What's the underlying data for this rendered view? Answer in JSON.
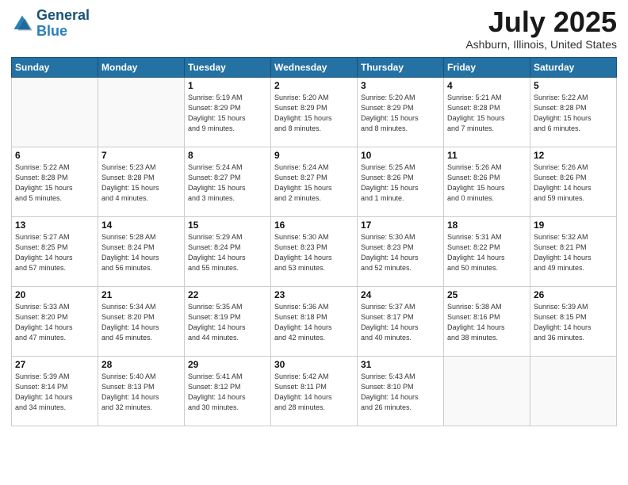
{
  "header": {
    "logo_line1": "General",
    "logo_line2": "Blue",
    "month": "July 2025",
    "location": "Ashburn, Illinois, United States"
  },
  "weekdays": [
    "Sunday",
    "Monday",
    "Tuesday",
    "Wednesday",
    "Thursday",
    "Friday",
    "Saturday"
  ],
  "weeks": [
    [
      {
        "day": "",
        "info": ""
      },
      {
        "day": "",
        "info": ""
      },
      {
        "day": "1",
        "info": "Sunrise: 5:19 AM\nSunset: 8:29 PM\nDaylight: 15 hours\nand 9 minutes."
      },
      {
        "day": "2",
        "info": "Sunrise: 5:20 AM\nSunset: 8:29 PM\nDaylight: 15 hours\nand 8 minutes."
      },
      {
        "day": "3",
        "info": "Sunrise: 5:20 AM\nSunset: 8:29 PM\nDaylight: 15 hours\nand 8 minutes."
      },
      {
        "day": "4",
        "info": "Sunrise: 5:21 AM\nSunset: 8:28 PM\nDaylight: 15 hours\nand 7 minutes."
      },
      {
        "day": "5",
        "info": "Sunrise: 5:22 AM\nSunset: 8:28 PM\nDaylight: 15 hours\nand 6 minutes."
      }
    ],
    [
      {
        "day": "6",
        "info": "Sunrise: 5:22 AM\nSunset: 8:28 PM\nDaylight: 15 hours\nand 5 minutes."
      },
      {
        "day": "7",
        "info": "Sunrise: 5:23 AM\nSunset: 8:28 PM\nDaylight: 15 hours\nand 4 minutes."
      },
      {
        "day": "8",
        "info": "Sunrise: 5:24 AM\nSunset: 8:27 PM\nDaylight: 15 hours\nand 3 minutes."
      },
      {
        "day": "9",
        "info": "Sunrise: 5:24 AM\nSunset: 8:27 PM\nDaylight: 15 hours\nand 2 minutes."
      },
      {
        "day": "10",
        "info": "Sunrise: 5:25 AM\nSunset: 8:26 PM\nDaylight: 15 hours\nand 1 minute."
      },
      {
        "day": "11",
        "info": "Sunrise: 5:26 AM\nSunset: 8:26 PM\nDaylight: 15 hours\nand 0 minutes."
      },
      {
        "day": "12",
        "info": "Sunrise: 5:26 AM\nSunset: 8:26 PM\nDaylight: 14 hours\nand 59 minutes."
      }
    ],
    [
      {
        "day": "13",
        "info": "Sunrise: 5:27 AM\nSunset: 8:25 PM\nDaylight: 14 hours\nand 57 minutes."
      },
      {
        "day": "14",
        "info": "Sunrise: 5:28 AM\nSunset: 8:24 PM\nDaylight: 14 hours\nand 56 minutes."
      },
      {
        "day": "15",
        "info": "Sunrise: 5:29 AM\nSunset: 8:24 PM\nDaylight: 14 hours\nand 55 minutes."
      },
      {
        "day": "16",
        "info": "Sunrise: 5:30 AM\nSunset: 8:23 PM\nDaylight: 14 hours\nand 53 minutes."
      },
      {
        "day": "17",
        "info": "Sunrise: 5:30 AM\nSunset: 8:23 PM\nDaylight: 14 hours\nand 52 minutes."
      },
      {
        "day": "18",
        "info": "Sunrise: 5:31 AM\nSunset: 8:22 PM\nDaylight: 14 hours\nand 50 minutes."
      },
      {
        "day": "19",
        "info": "Sunrise: 5:32 AM\nSunset: 8:21 PM\nDaylight: 14 hours\nand 49 minutes."
      }
    ],
    [
      {
        "day": "20",
        "info": "Sunrise: 5:33 AM\nSunset: 8:20 PM\nDaylight: 14 hours\nand 47 minutes."
      },
      {
        "day": "21",
        "info": "Sunrise: 5:34 AM\nSunset: 8:20 PM\nDaylight: 14 hours\nand 45 minutes."
      },
      {
        "day": "22",
        "info": "Sunrise: 5:35 AM\nSunset: 8:19 PM\nDaylight: 14 hours\nand 44 minutes."
      },
      {
        "day": "23",
        "info": "Sunrise: 5:36 AM\nSunset: 8:18 PM\nDaylight: 14 hours\nand 42 minutes."
      },
      {
        "day": "24",
        "info": "Sunrise: 5:37 AM\nSunset: 8:17 PM\nDaylight: 14 hours\nand 40 minutes."
      },
      {
        "day": "25",
        "info": "Sunrise: 5:38 AM\nSunset: 8:16 PM\nDaylight: 14 hours\nand 38 minutes."
      },
      {
        "day": "26",
        "info": "Sunrise: 5:39 AM\nSunset: 8:15 PM\nDaylight: 14 hours\nand 36 minutes."
      }
    ],
    [
      {
        "day": "27",
        "info": "Sunrise: 5:39 AM\nSunset: 8:14 PM\nDaylight: 14 hours\nand 34 minutes."
      },
      {
        "day": "28",
        "info": "Sunrise: 5:40 AM\nSunset: 8:13 PM\nDaylight: 14 hours\nand 32 minutes."
      },
      {
        "day": "29",
        "info": "Sunrise: 5:41 AM\nSunset: 8:12 PM\nDaylight: 14 hours\nand 30 minutes."
      },
      {
        "day": "30",
        "info": "Sunrise: 5:42 AM\nSunset: 8:11 PM\nDaylight: 14 hours\nand 28 minutes."
      },
      {
        "day": "31",
        "info": "Sunrise: 5:43 AM\nSunset: 8:10 PM\nDaylight: 14 hours\nand 26 minutes."
      },
      {
        "day": "",
        "info": ""
      },
      {
        "day": "",
        "info": ""
      }
    ]
  ]
}
